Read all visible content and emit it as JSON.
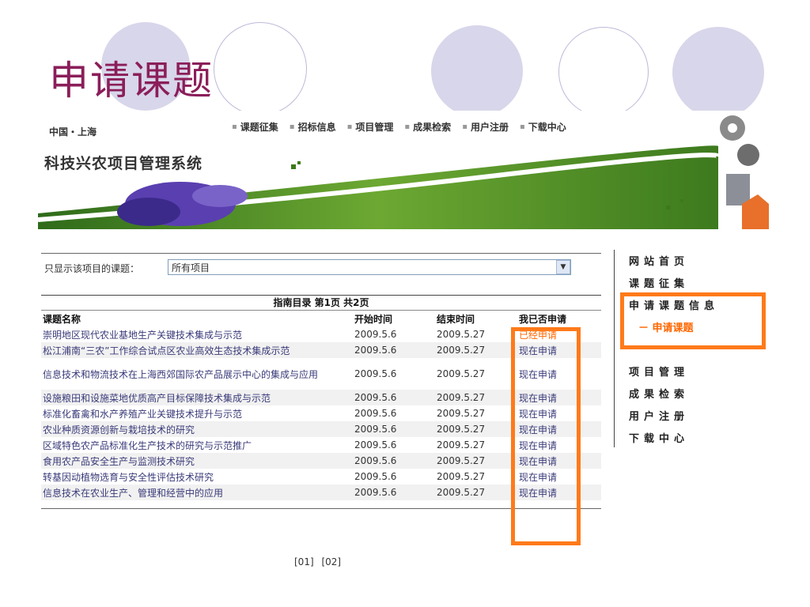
{
  "slide_title": "申请课题",
  "header": {
    "location": "中国・上海",
    "system_name": "科技兴农项目管理系统",
    "nav": [
      "课题征集",
      "招标信息",
      "项目管理",
      "成果检索",
      "用户注册",
      "下载中心"
    ]
  },
  "filter": {
    "label": "只显示该项目的课题：",
    "selected": "所有项目"
  },
  "table": {
    "caption": "指南目录 第1页 共2页",
    "columns": [
      "课题名称",
      "开始时间",
      "结束时间",
      "我已否申请"
    ],
    "rows": [
      {
        "name": "崇明地区现代农业基地生产关键技术集成与示范",
        "start": "2009.5.6",
        "end": "2009.5.27",
        "status": "已经申请"
      },
      {
        "name": "松江浦南“三农”工作综合试点区农业高效生态技术集成示范",
        "start": "2009.5.6",
        "end": "2009.5.27",
        "status": "现在申请"
      },
      {
        "name": "信息技术和物流技术在上海西郊国际农产品展示中心的集成与应用",
        "start": "2009.5.6",
        "end": "2009.5.27",
        "status": "现在申请"
      },
      {
        "name": "设施粮田和设施菜地优质高产目标保障技术集成与示范",
        "start": "2009.5.6",
        "end": "2009.5.27",
        "status": "现在申请"
      },
      {
        "name": "标准化畜禽和水产养殖产业关键技术提升与示范",
        "start": "2009.5.6",
        "end": "2009.5.27",
        "status": "现在申请"
      },
      {
        "name": "农业种质资源创新与栽培技术的研究",
        "start": "2009.5.6",
        "end": "2009.5.27",
        "status": "现在申请"
      },
      {
        "name": "区域特色农产品标准化生产技术的研究与示范推广",
        "start": "2009.5.6",
        "end": "2009.5.27",
        "status": "现在申请"
      },
      {
        "name": "食用农产品安全生产与监测技术研究",
        "start": "2009.5.6",
        "end": "2009.5.27",
        "status": "现在申请"
      },
      {
        "name": "转基因动植物选育与安全性评估技术研究",
        "start": "2009.5.6",
        "end": "2009.5.27",
        "status": "现在申请"
      },
      {
        "name": "信息技术在农业生产、管理和经营中的应用",
        "start": "2009.5.6",
        "end": "2009.5.27",
        "status": "现在申请"
      }
    ]
  },
  "pager": [
    "[01]",
    "[02]"
  ],
  "side_menu": {
    "home": "网站首页",
    "collect": "课题征集",
    "apply_info": "申请课题信息",
    "apply_sub": "－ 申请课题",
    "project": "项目管理",
    "result": "成果检索",
    "register": "用户注册",
    "download": "下载中心"
  },
  "colors": {
    "highlight": "#ff7a1a",
    "title": "#8b1e5a",
    "applied": "#ff6600"
  }
}
